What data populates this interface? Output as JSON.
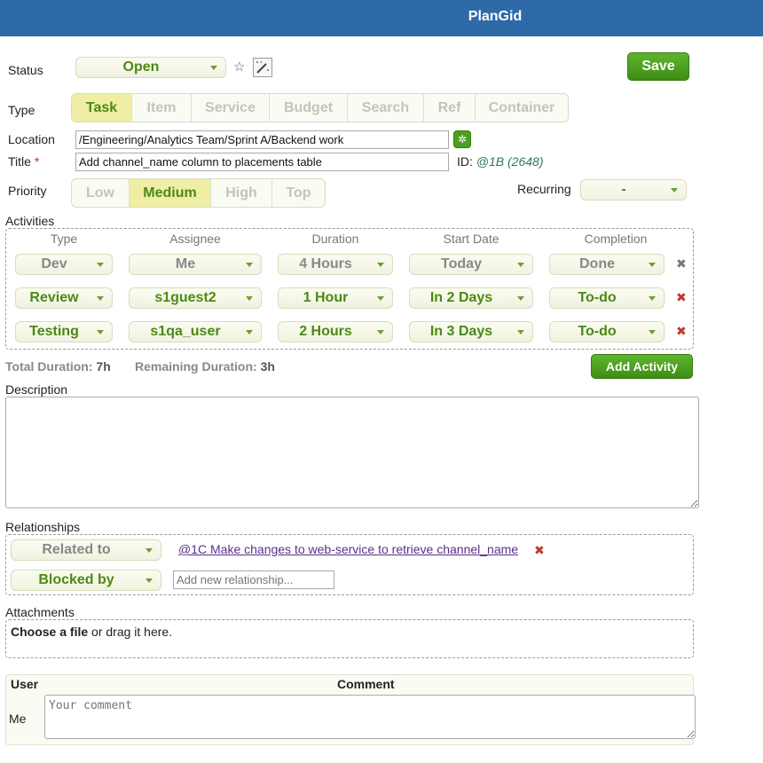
{
  "app": {
    "title": "PlanGid"
  },
  "form": {
    "status_label": "Status",
    "status_value": "Open",
    "save_label": "Save",
    "type_label": "Type",
    "type_options": [
      "Task",
      "Item",
      "Service",
      "Budget",
      "Search",
      "Ref",
      "Container"
    ],
    "type_selected": "Task",
    "location_label": "Location",
    "location_value": "/Engineering/Analytics Team/Sprint A/Backend work",
    "title_label": "Title",
    "title_required_mark": "*",
    "title_value": "Add channel_name column to placements table",
    "id_label": "ID:",
    "id_value": "@1B (2648)",
    "priority_label": "Priority",
    "priority_options": [
      "Low",
      "Medium",
      "High",
      "Top"
    ],
    "priority_selected": "Medium",
    "recurring_label": "Recurring",
    "recurring_value": "-"
  },
  "activities": {
    "label": "Activities",
    "columns": [
      "Type",
      "Assignee",
      "Duration",
      "Start Date",
      "Completion"
    ],
    "rows": [
      {
        "type": "Dev",
        "assignee": "Me",
        "duration": "4 Hours",
        "start": "Today",
        "completion": "Done",
        "muted": true
      },
      {
        "type": "Review",
        "assignee": "s1guest2",
        "duration": "1 Hour",
        "start": "In 2 Days",
        "completion": "To-do",
        "muted": false
      },
      {
        "type": "Testing",
        "assignee": "s1qa_user",
        "duration": "2 Hours",
        "start": "In 3 Days",
        "completion": "To-do",
        "muted": false
      }
    ],
    "total_label": "Total Duration:",
    "total_value": "7h",
    "remaining_label": "Remaining Duration:",
    "remaining_value": "3h",
    "add_label": "Add Activity"
  },
  "description": {
    "label": "Description",
    "value": ""
  },
  "relationships": {
    "label": "Relationships",
    "items": [
      {
        "kind": "Related to",
        "target": "@1C Make changes to web-service to retrieve channel_name"
      }
    ],
    "new_kind": "Blocked by",
    "new_placeholder": "Add new relationship..."
  },
  "attachments": {
    "label": "Attachments",
    "choose_label": "Choose a file",
    "drag_text": "or drag it here."
  },
  "comments": {
    "user_header": "User",
    "comment_header": "Comment",
    "current_user": "Me",
    "placeholder": "Your comment"
  },
  "colors": {
    "header": "#2f6aa8",
    "accent_green": "#4a8a14",
    "button_green": "#4ca01f",
    "active_segment": "#f0eea5",
    "delete_red": "#c0392b",
    "link_purple": "#5a2f8a"
  },
  "icons": {
    "favorite": "star-icon",
    "magic": "magic-wand-icon",
    "location_picker": "gear-icon",
    "delete": "close-icon"
  }
}
